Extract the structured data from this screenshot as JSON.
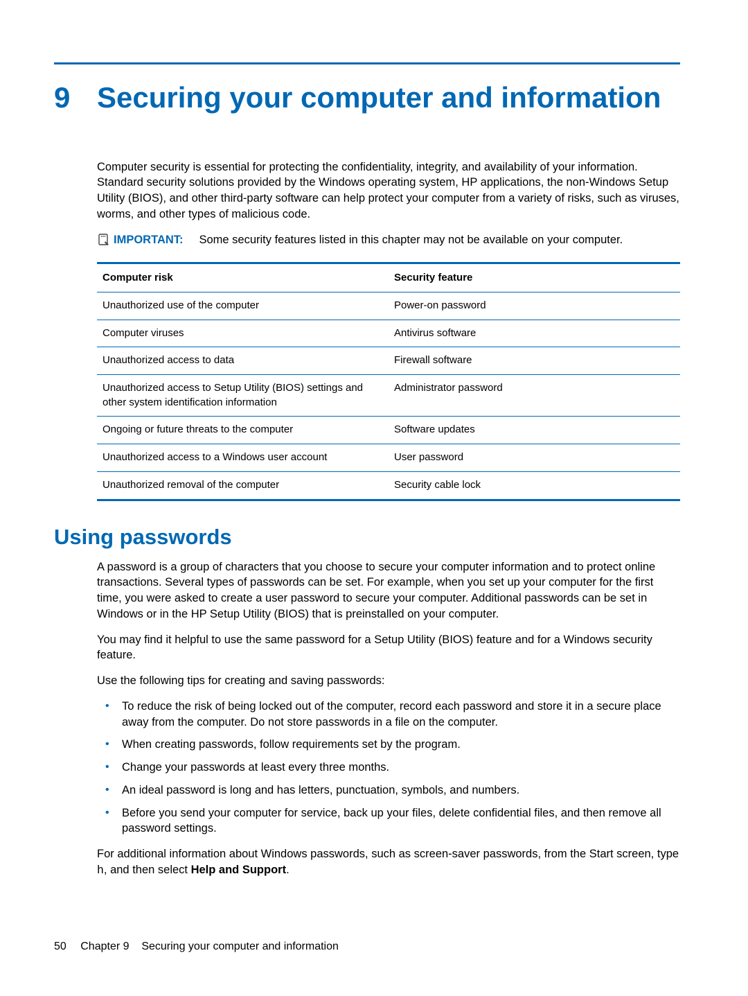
{
  "chapter": {
    "number": "9",
    "title": "Securing your computer and information"
  },
  "intro": "Computer security is essential for protecting the confidentiality, integrity, and availability of your information. Standard security solutions provided by the Windows operating system, HP applications, the non-Windows Setup Utility (BIOS), and other third-party software can help protect your computer from a variety of risks, such as viruses, worms, and other types of malicious code.",
  "important": {
    "label": "IMPORTANT:",
    "text": "Some security features listed in this chapter may not be available on your computer."
  },
  "table": {
    "headers": [
      "Computer risk",
      "Security feature"
    ],
    "rows": [
      [
        "Unauthorized use of the computer",
        "Power-on password"
      ],
      [
        "Computer viruses",
        "Antivirus software"
      ],
      [
        "Unauthorized access to data",
        "Firewall software"
      ],
      [
        "Unauthorized access to Setup Utility (BIOS) settings and other system identification information",
        "Administrator password"
      ],
      [
        "Ongoing or future threats to the computer",
        "Software updates"
      ],
      [
        "Unauthorized access to a Windows user account",
        "User password"
      ],
      [
        "Unauthorized removal of the computer",
        "Security cable lock"
      ]
    ]
  },
  "section": {
    "heading": "Using passwords",
    "p1": "A password is a group of characters that you choose to secure your computer information and to protect online transactions. Several types of passwords can be set. For example, when you set up your computer for the first time, you were asked to create a user password to secure your computer. Additional passwords can be set in Windows or in the HP Setup Utility (BIOS) that is preinstalled on your computer.",
    "p2": "You may find it helpful to use the same password for a Setup Utility (BIOS) feature and for a Windows security feature.",
    "p3": "Use the following tips for creating and saving passwords:",
    "bullets": [
      "To reduce the risk of being locked out of the computer, record each password and store it in a secure place away from the computer. Do not store passwords in a file on the computer.",
      "When creating passwords, follow requirements set by the program.",
      "Change your passwords at least every three months.",
      "An ideal password is long and has letters, punctuation, symbols, and numbers.",
      "Before you send your computer for service, back up your files, delete confidential files, and then remove all password settings."
    ],
    "p4_pre": "For additional information about Windows passwords, such as screen-saver passwords, from the Start screen, type ",
    "p4_code": "h",
    "p4_mid": ", and then select ",
    "p4_bold": "Help and Support",
    "p4_end": "."
  },
  "footer": {
    "page": "50",
    "chapter_label": "Chapter 9",
    "chapter_title": "Securing your computer and information"
  }
}
